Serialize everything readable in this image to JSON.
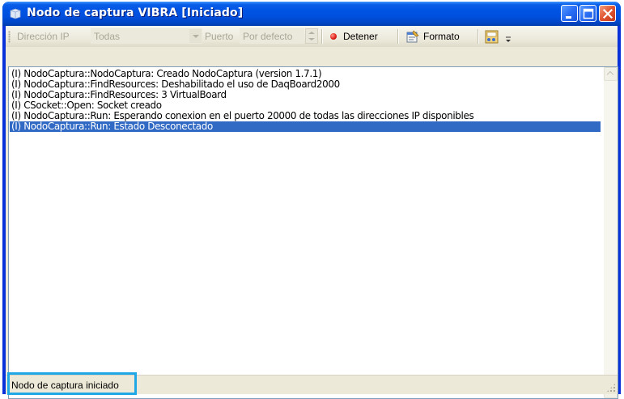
{
  "window": {
    "title": "Nodo de captura VIBRA [Iniciado]",
    "icon": "app-window-icon",
    "controls": [
      "minimize-icon",
      "maximize-icon",
      "close-icon"
    ]
  },
  "toolbar": {
    "ip_label": "Dirección IP",
    "ip_value": "Todas",
    "port_label": "Puerto",
    "port_value": "Por defecto",
    "stop_label": "Detener",
    "format_label": "Formato",
    "icons": [
      "stop-record-icon",
      "format-icon",
      "settings-icon",
      "overflow-chevron-icon"
    ]
  },
  "log": {
    "lines": [
      "(I) NodoCaptura::NodoCaptura: Creado NodoCaptura (version 1.7.1)",
      "(I) NodoCaptura::FindResources: Deshabilitado el uso de DaqBoard2000",
      "(I) NodoCaptura::FindResources: 3 VirtualBoard",
      "(I) CSocket::Open: Socket creado",
      "(I) NodoCaptura::Run: Esperando conexion en el puerto 20000 de todas las direcciones IP disponibles",
      "(I) NodoCaptura::Run: Estado Desconectado"
    ],
    "selected_index": 5
  },
  "status": {
    "text": "Nodo de captura iniciado"
  },
  "colors": {
    "titlebar": "#0054e3",
    "selection": "#316ac5",
    "highlight_box": "#1fa7e6",
    "stop_dot": "#e0201a"
  }
}
